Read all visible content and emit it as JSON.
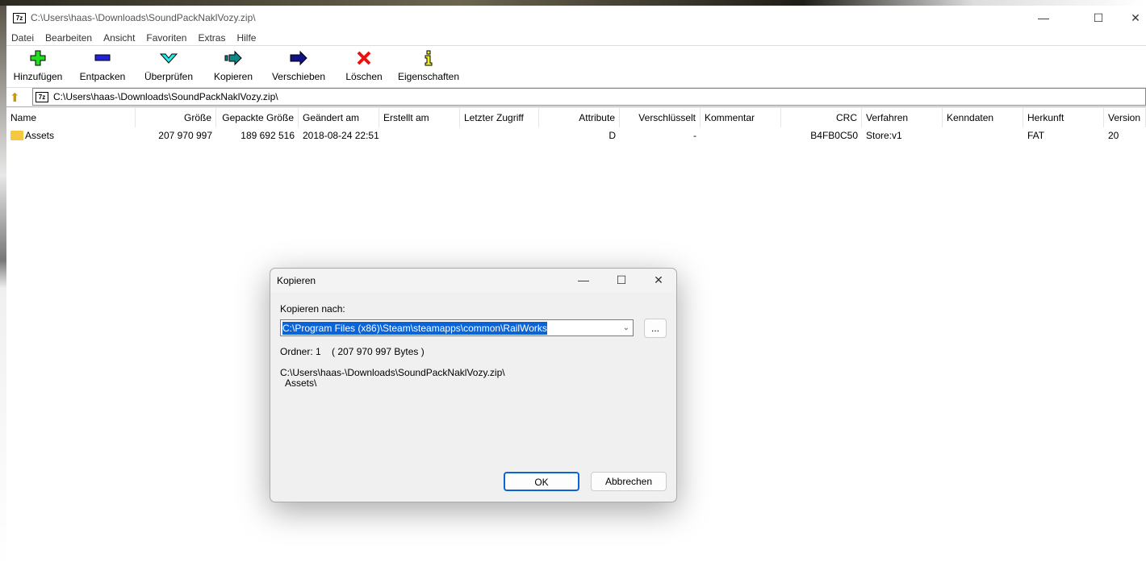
{
  "window": {
    "title": "C:\\Users\\haas-\\Downloads\\SoundPackNaklVozy.zip\\",
    "icon_text": "7z"
  },
  "menu": [
    "Datei",
    "Bearbeiten",
    "Ansicht",
    "Favoriten",
    "Extras",
    "Hilfe"
  ],
  "toolbar": [
    {
      "label": "Hinzufügen",
      "icon": "plus-icon"
    },
    {
      "label": "Entpacken",
      "icon": "minus-icon"
    },
    {
      "label": "Überprüfen",
      "icon": "check-icon"
    },
    {
      "label": "Kopieren",
      "icon": "copy-arrow-icon"
    },
    {
      "label": "Verschieben",
      "icon": "move-arrow-icon"
    },
    {
      "label": "Löschen",
      "icon": "delete-x-icon"
    },
    {
      "label": "Eigenschaften",
      "icon": "info-icon"
    }
  ],
  "address": "C:\\Users\\haas-\\Downloads\\SoundPackNaklVozy.zip\\",
  "columns": [
    "Name",
    "Größe",
    "Gepackte Größe",
    "Geändert am",
    "Erstellt am",
    "Letzter Zugriff",
    "Attribute",
    "Verschlüsselt",
    "Kommentar",
    "CRC",
    "Verfahren",
    "Kenndaten",
    "Herkunft",
    "Version"
  ],
  "rows": [
    [
      "Assets",
      "207 970 997",
      "189 692 516",
      "2018-08-24 22:51",
      "",
      "",
      "D",
      "-",
      "",
      "B4FB0C50",
      "Store:v1",
      "",
      "FAT",
      "20"
    ]
  ],
  "dialog": {
    "title": "Kopieren",
    "label": "Kopieren nach:",
    "path": "C:\\Program Files (x86)\\Steam\\steamapps\\common\\RailWorks",
    "browse": "...",
    "info": "Ordner: 1    ( 207 970 997 Bytes )",
    "source": "C:\\Users\\haas-\\Downloads\\SoundPackNaklVozy.zip\\",
    "source_item": "Assets\\",
    "ok": "OK",
    "cancel": "Abbrechen"
  }
}
